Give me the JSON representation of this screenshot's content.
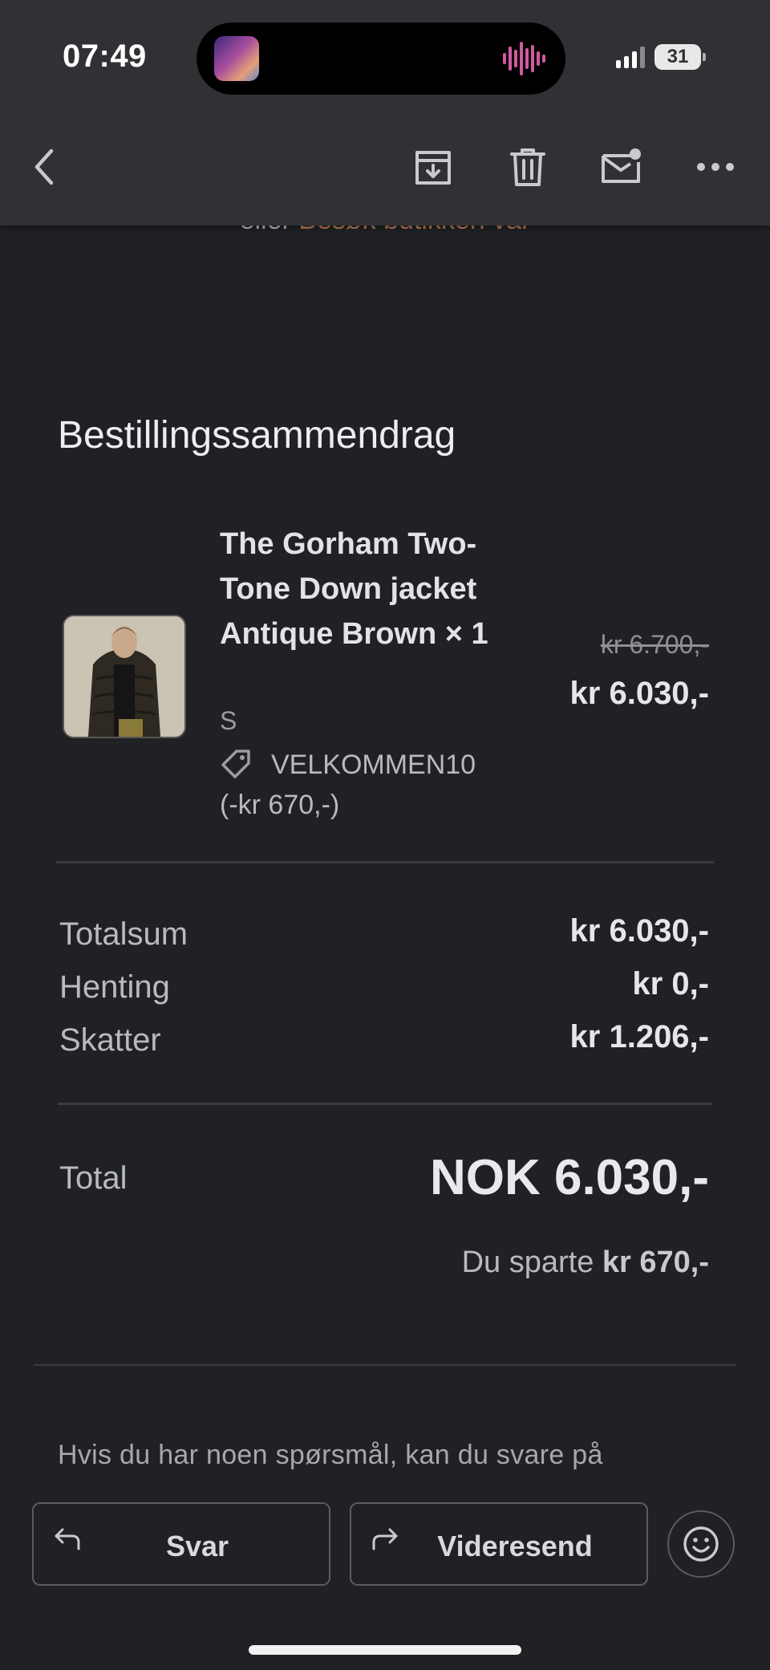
{
  "status_bar": {
    "time": "07:49",
    "battery": "31"
  },
  "toolbar": {
    "back": "chevron-left-icon",
    "archive": "archive-icon",
    "delete": "trash-icon",
    "mark_unread": "mail-unread-icon",
    "more": "more-horizontal-icon"
  },
  "email": {
    "peek_text_prefix": "eller",
    "peek_link": "Besøk butikken vår",
    "summary_title": "Bestillingssammendrag",
    "product": {
      "name": "The Gorham Two-Tone Down jacket Antique Brown × 1",
      "size": "S",
      "discount_code": "VELKOMMEN10",
      "discount_amount": "(-kr 670,-)",
      "original_price": "kr 6.700,-",
      "price": "kr 6.030,-"
    },
    "totals": [
      {
        "label": "Totalsum",
        "value": "kr 6.030,-"
      },
      {
        "label": "Henting",
        "value": "kr 0,-"
      },
      {
        "label": "Skatter",
        "value": "kr 1.206,-"
      }
    ],
    "total_label": "Total",
    "total_value": "NOK 6.030,-",
    "saved_prefix": "Du sparte",
    "saved_amount": "kr 670,-",
    "footer_text": "Hvis du har noen spørsmål, kan du svare på"
  },
  "actions": {
    "reply": "Svar",
    "forward": "Videresend",
    "emoji": "smiley-icon"
  },
  "colors": {
    "background": "#202124",
    "toolbar": "#303134",
    "link": "#b87c56"
  }
}
